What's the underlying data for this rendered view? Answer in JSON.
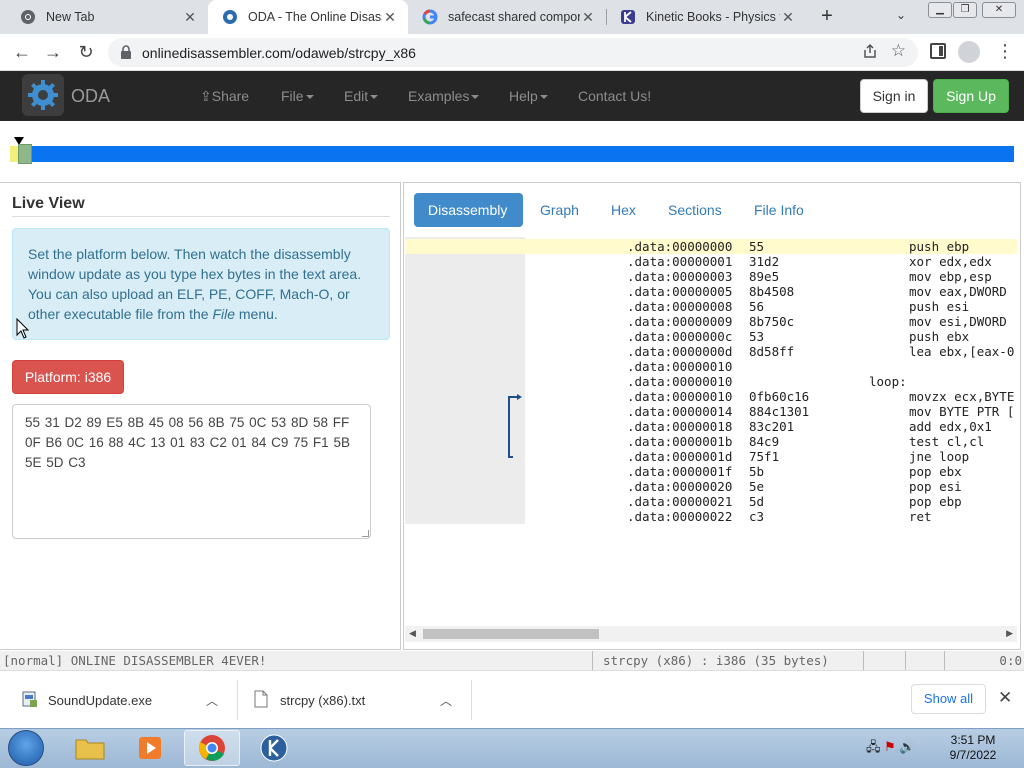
{
  "browser": {
    "tabs": [
      {
        "title": "New Tab",
        "icon": "chrome-icon"
      },
      {
        "title": "ODA - The Online Disasse",
        "icon": "oda-gear-icon"
      },
      {
        "title": "safecast shared compone",
        "icon": "google-icon"
      },
      {
        "title": "Kinetic Books - Physics fo",
        "icon": "kinetic-icon"
      }
    ],
    "url": "onlinedisassembler.com/odaweb/strcpy_x86"
  },
  "oda_nav": {
    "brand": "ODA",
    "links": [
      "Share",
      "File",
      "Edit",
      "Examples",
      "Help",
      "Contact Us!"
    ],
    "signin": "Sign in",
    "signup": "Sign Up"
  },
  "live_view": {
    "title": "Live View",
    "info_pre": "Set the platform below. Then watch the disassembly window update as you type hex bytes in the text area. You can also upload an ELF, PE, COFF, Mach-O, or other executable file from the ",
    "info_em": "File",
    "info_post": " menu.",
    "platform_button": "Platform: i386",
    "hex_bytes": "55 31 D2 89 E5 8B 45 08 56 8B 75 0C 53 8D 58 FF 0F B6 0C 16 88 4C 13 01 83 C2 01 84 C9 75 F1 5B 5E 5D C3"
  },
  "right_tabs": [
    "Disassembly",
    "Graph",
    "Hex",
    "Sections",
    "File Info"
  ],
  "disassembly": [
    {
      "addr": ".data:00000000",
      "bytes": "55",
      "ins": "push ebp",
      "label": ""
    },
    {
      "addr": ".data:00000001",
      "bytes": "31d2",
      "ins": "xor edx,edx",
      "label": ""
    },
    {
      "addr": ".data:00000003",
      "bytes": "89e5",
      "ins": "mov ebp,esp",
      "label": ""
    },
    {
      "addr": ".data:00000005",
      "bytes": "8b4508",
      "ins": "mov eax,DWORD",
      "label": ""
    },
    {
      "addr": ".data:00000008",
      "bytes": "56",
      "ins": "push esi",
      "label": ""
    },
    {
      "addr": ".data:00000009",
      "bytes": "8b750c",
      "ins": "mov esi,DWORD",
      "label": ""
    },
    {
      "addr": ".data:0000000c",
      "bytes": "53",
      "ins": "push ebx",
      "label": ""
    },
    {
      "addr": ".data:0000000d",
      "bytes": "8d58ff",
      "ins": "lea ebx,[eax-0",
      "label": ""
    },
    {
      "addr": ".data:00000010",
      "bytes": "",
      "ins": "",
      "label": ""
    },
    {
      "addr": ".data:00000010",
      "bytes": "",
      "ins": "",
      "label": "loop:"
    },
    {
      "addr": ".data:00000010",
      "bytes": "0fb60c16",
      "ins": "movzx ecx,BYTE",
      "label": ""
    },
    {
      "addr": ".data:00000014",
      "bytes": "884c1301",
      "ins": "mov BYTE PTR [",
      "label": ""
    },
    {
      "addr": ".data:00000018",
      "bytes": "83c201",
      "ins": "add edx,0x1",
      "label": ""
    },
    {
      "addr": ".data:0000001b",
      "bytes": "84c9",
      "ins": "test cl,cl",
      "label": ""
    },
    {
      "addr": ".data:0000001d",
      "bytes": "75f1",
      "ins": "jne loop",
      "label": ""
    },
    {
      "addr": ".data:0000001f",
      "bytes": "5b",
      "ins": "pop ebx",
      "label": ""
    },
    {
      "addr": ".data:00000020",
      "bytes": "5e",
      "ins": "pop esi",
      "label": ""
    },
    {
      "addr": ".data:00000021",
      "bytes": "5d",
      "ins": "pop ebp",
      "label": ""
    },
    {
      "addr": ".data:00000022",
      "bytes": "c3",
      "ins": "ret",
      "label": ""
    }
  ],
  "status": {
    "left": "[normal] ONLINE DISASSEMBLER 4EVER!",
    "middle": "strcpy (x86) : i386 (35 bytes)",
    "right": "0:0"
  },
  "downloads": {
    "items": [
      "SoundUpdate.exe",
      "strcpy (x86).txt"
    ],
    "show_all": "Show all"
  },
  "taskbar": {
    "time": "3:51 PM",
    "date": "9/7/2022"
  },
  "colors": {
    "oda_nav_bg": "#262626",
    "signup_green": "#5cb85c",
    "platform_red": "#d9534f",
    "active_tab_blue": "#428bca",
    "position_bar_blue": "#0a74f0",
    "info_bg": "#d9edf7"
  }
}
